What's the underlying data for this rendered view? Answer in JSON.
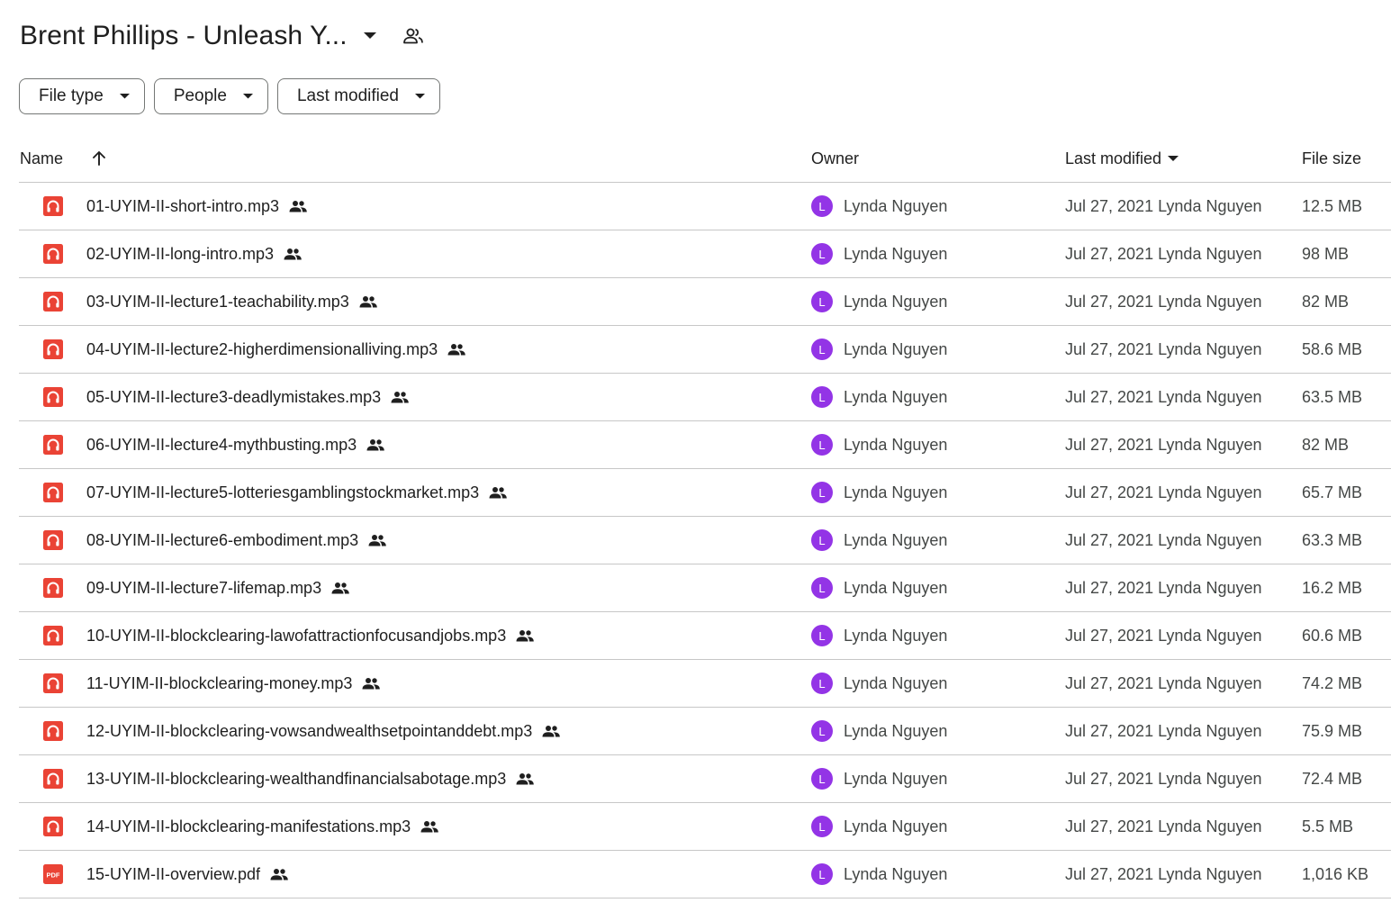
{
  "header": {
    "title": "Brent Phillips - Unleash Y...",
    "title_caret_icon": "arrow-drop-down-icon",
    "shared_icon": "people-outline-icon"
  },
  "filters": [
    {
      "label": "File type"
    },
    {
      "label": "People"
    },
    {
      "label": "Last modified"
    }
  ],
  "table": {
    "columns": {
      "name": "Name",
      "owner": "Owner",
      "last_modified": "Last modified",
      "file_size": "File size"
    },
    "sort_icon": "arrow-upward-icon",
    "rows": [
      {
        "name": "01-UYIM-II-short-intro.mp3",
        "type": "audio",
        "owner": "Lynda Nguyen",
        "owner_initial": "L",
        "modified": "Jul 27, 2021 Lynda Nguyen",
        "size": "12.5 MB"
      },
      {
        "name": "02-UYIM-II-long-intro.mp3",
        "type": "audio",
        "owner": "Lynda Nguyen",
        "owner_initial": "L",
        "modified": "Jul 27, 2021 Lynda Nguyen",
        "size": "98 MB"
      },
      {
        "name": "03-UYIM-II-lecture1-teachability.mp3",
        "type": "audio",
        "owner": "Lynda Nguyen",
        "owner_initial": "L",
        "modified": "Jul 27, 2021 Lynda Nguyen",
        "size": "82 MB"
      },
      {
        "name": "04-UYIM-II-lecture2-higherdimensionalliving.mp3",
        "type": "audio",
        "owner": "Lynda Nguyen",
        "owner_initial": "L",
        "modified": "Jul 27, 2021 Lynda Nguyen",
        "size": "58.6 MB"
      },
      {
        "name": "05-UYIM-II-lecture3-deadlymistakes.mp3",
        "type": "audio",
        "owner": "Lynda Nguyen",
        "owner_initial": "L",
        "modified": "Jul 27, 2021 Lynda Nguyen",
        "size": "63.5 MB"
      },
      {
        "name": "06-UYIM-II-lecture4-mythbusting.mp3",
        "type": "audio",
        "owner": "Lynda Nguyen",
        "owner_initial": "L",
        "modified": "Jul 27, 2021 Lynda Nguyen",
        "size": "82 MB"
      },
      {
        "name": "07-UYIM-II-lecture5-lotteriesgamblingstockmarket.mp3",
        "type": "audio",
        "owner": "Lynda Nguyen",
        "owner_initial": "L",
        "modified": "Jul 27, 2021 Lynda Nguyen",
        "size": "65.7 MB"
      },
      {
        "name": "08-UYIM-II-lecture6-embodiment.mp3",
        "type": "audio",
        "owner": "Lynda Nguyen",
        "owner_initial": "L",
        "modified": "Jul 27, 2021 Lynda Nguyen",
        "size": "63.3 MB"
      },
      {
        "name": "09-UYIM-II-lecture7-lifemap.mp3",
        "type": "audio",
        "owner": "Lynda Nguyen",
        "owner_initial": "L",
        "modified": "Jul 27, 2021 Lynda Nguyen",
        "size": "16.2 MB"
      },
      {
        "name": "10-UYIM-II-blockclearing-lawofattractionfocusandjobs.mp3",
        "type": "audio",
        "owner": "Lynda Nguyen",
        "owner_initial": "L",
        "modified": "Jul 27, 2021 Lynda Nguyen",
        "size": "60.6 MB"
      },
      {
        "name": "11-UYIM-II-blockclearing-money.mp3",
        "type": "audio",
        "owner": "Lynda Nguyen",
        "owner_initial": "L",
        "modified": "Jul 27, 2021 Lynda Nguyen",
        "size": "74.2 MB"
      },
      {
        "name": "12-UYIM-II-blockclearing-vowsandwealthsetpointanddebt.mp3",
        "type": "audio",
        "owner": "Lynda Nguyen",
        "owner_initial": "L",
        "modified": "Jul 27, 2021 Lynda Nguyen",
        "size": "75.9 MB"
      },
      {
        "name": "13-UYIM-II-blockclearing-wealthandfinancialsabotage.mp3",
        "type": "audio",
        "owner": "Lynda Nguyen",
        "owner_initial": "L",
        "modified": "Jul 27, 2021 Lynda Nguyen",
        "size": "72.4 MB"
      },
      {
        "name": "14-UYIM-II-blockclearing-manifestations.mp3",
        "type": "audio",
        "owner": "Lynda Nguyen",
        "owner_initial": "L",
        "modified": "Jul 27, 2021 Lynda Nguyen",
        "size": "5.5 MB"
      },
      {
        "name": "15-UYIM-II-overview.pdf",
        "type": "pdf",
        "owner": "Lynda Nguyen",
        "owner_initial": "L",
        "modified": "Jul 27, 2021 Lynda Nguyen",
        "size": "1,016 KB"
      }
    ]
  },
  "icons": {
    "audio": "headphones-file-icon",
    "pdf": "pdf-file-icon",
    "shared": "shared-people-icon"
  },
  "pdf_icon_label": "PDF",
  "colors": {
    "file_icon_red": "#ea4335",
    "avatar_purple": "#9334e6",
    "divider": "#c7c7c7",
    "chip_border": "#747775",
    "secondary_text": "#444746"
  }
}
